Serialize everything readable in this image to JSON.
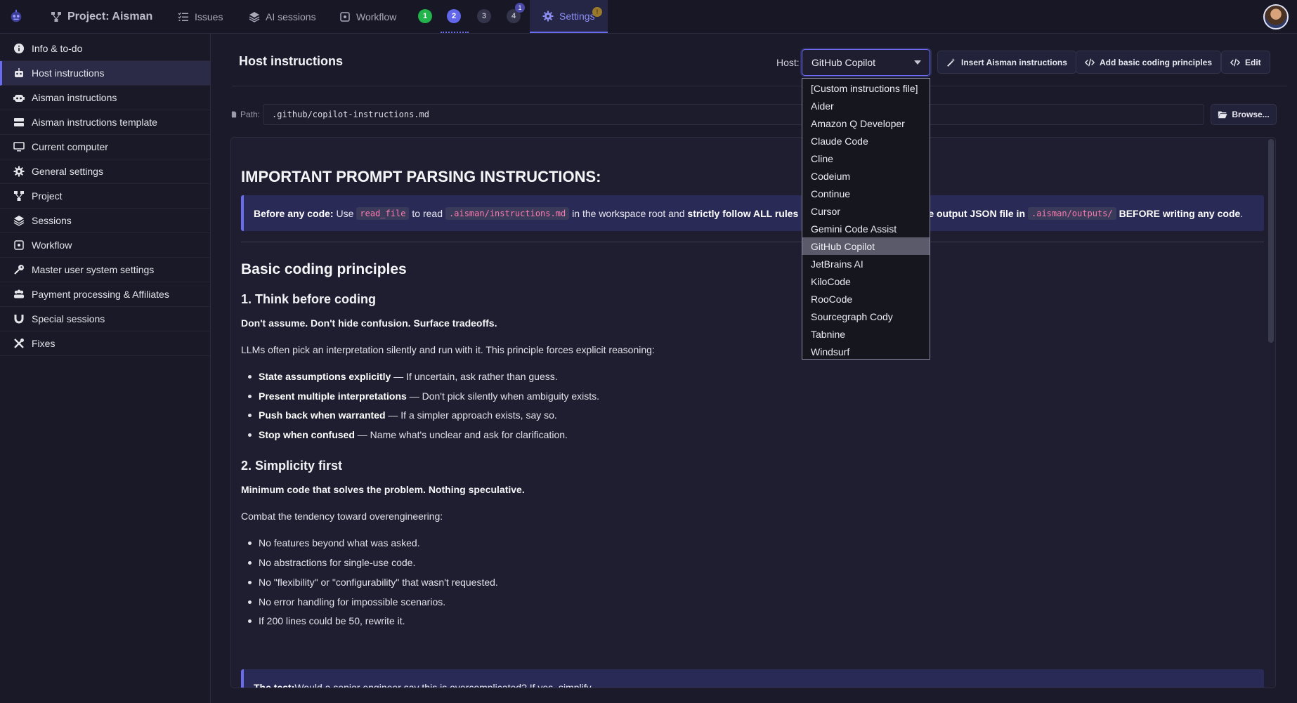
{
  "topbar": {
    "project_label": "Project: Aisman",
    "issues_label": "Issues",
    "ai_sessions_label": "AI sessions",
    "workflow_label": "Workflow",
    "steps": [
      "1",
      "2",
      "3",
      "4"
    ],
    "step4_badge": "1",
    "settings_label": "Settings",
    "settings_badge": "!"
  },
  "sidebar": {
    "items": [
      {
        "label": "Info & to-do",
        "icon": "info-icon"
      },
      {
        "label": "Host instructions",
        "icon": "robot-icon"
      },
      {
        "label": "Aisman instructions",
        "icon": "robot-face-icon"
      },
      {
        "label": "Aisman instructions template",
        "icon": "server-icon"
      },
      {
        "label": "Current computer",
        "icon": "monitor-icon"
      },
      {
        "label": "General settings",
        "icon": "gear-icon"
      },
      {
        "label": "Project",
        "icon": "project-diagram-icon"
      },
      {
        "label": "Sessions",
        "icon": "layers-icon"
      },
      {
        "label": "Workflow",
        "icon": "workflow-icon"
      },
      {
        "label": "Master user system settings",
        "icon": "key-icon"
      },
      {
        "label": "Payment processing & Affiliates",
        "icon": "users-icon"
      },
      {
        "label": "Special sessions",
        "icon": "magnet-icon"
      },
      {
        "label": "Fixes",
        "icon": "tools-icon"
      }
    ]
  },
  "main": {
    "title": "Host instructions",
    "host_label": "Host:",
    "host_selected": "GitHub Copilot",
    "buttons": {
      "insert_aisman": "Insert Aisman instructions",
      "add_principles": "Add basic coding principles",
      "edit": "Edit"
    },
    "path_label": "Path:",
    "path_value": ".github/copilot-instructions.md",
    "browse_label": "Browse..."
  },
  "host_options": [
    "[Custom instructions file]",
    "Aider",
    "Amazon Q Developer",
    "Claude Code",
    "Cline",
    "Codeium",
    "Continue",
    "Cursor",
    "Gemini Code Assist",
    "GitHub Copilot",
    "JetBrains AI",
    "KiloCode",
    "RooCode",
    "Sourcegraph Cody",
    "Tabnine",
    "Windsurf"
  ],
  "doc": {
    "h1": "IMPORTANT PROMPT PARSING INSTRUCTIONS:",
    "callout1": {
      "lead": "Before any code:",
      "t1": "Use",
      "code1": "read_file",
      "t2": "to read",
      "code2": ".aisman/instructions.md",
      "t3": "in the workspace root and",
      "strong1": "strictly follow ALL rules",
      "strong2": "e output JSON file in",
      "code3": ".aisman/outputs/",
      "strong3": "BEFORE writing any code",
      "end": "."
    },
    "h2": "Basic coding principles",
    "s1_title": "1. Think before coding",
    "s1_lead": "Don't assume. Don't hide confusion. Surface tradeoffs.",
    "s1_para": "LLMs often pick an interpretation silently and run with it. This principle forces explicit reasoning:",
    "s1_items": [
      {
        "b": "State assumptions explicitly",
        "t": " — If uncertain, ask rather than guess."
      },
      {
        "b": "Present multiple interpretations",
        "t": " — Don't pick silently when ambiguity exists."
      },
      {
        "b": "Push back when warranted",
        "t": " — If a simpler approach exists, say so."
      },
      {
        "b": "Stop when confused",
        "t": " — Name what's unclear and ask for clarification."
      }
    ],
    "s2_title": "2. Simplicity first",
    "s2_lead": "Minimum code that solves the problem. Nothing speculative.",
    "s2_para": "Combat the tendency toward overengineering:",
    "s2_items": [
      "No features beyond what was asked.",
      "No abstractions for single-use code.",
      "No \"flexibility\" or \"configurability\" that wasn't requested.",
      "No error handling for impossible scenarios.",
      "If 200 lines could be 50, rewrite it."
    ],
    "callout2": {
      "lead": "The test:",
      "text": " Would a senior engineer say this is overcomplicated? If yes, simplify."
    }
  },
  "colors": {
    "accent": "#6a6cf0",
    "background": "#1a1a2a",
    "callout_bg": "#2a2a56",
    "code_pink": "#ff7ab0",
    "step_green": "#22b34a"
  }
}
